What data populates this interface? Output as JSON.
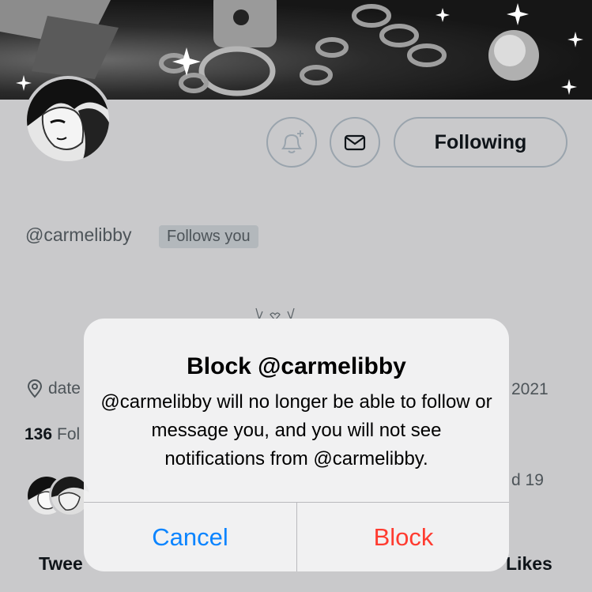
{
  "profile": {
    "handle": "@carmelibby",
    "follows_you_badge": "Follows you",
    "location": "date",
    "joined_fragment": "2021",
    "followers_count": "136",
    "followers_label": "Fol",
    "followed_by_fragment": "d 19",
    "bio_glyph": "ᶻ♡ᶻ"
  },
  "actions": {
    "notify_icon": "bell-plus-icon",
    "message_icon": "envelope-icon",
    "following_label": "Following"
  },
  "tabs": {
    "first": "Twee",
    "last": "Likes"
  },
  "alert": {
    "title": "Block @carmelibby",
    "message": "@carmelibby will no longer be able to follow or message you, and you will not see notifications from @carmelibby.",
    "cancel_label": "Cancel",
    "block_label": "Block"
  },
  "colors": {
    "cancel": "#0a84ff",
    "block": "#ff3b30",
    "dim_background": "#c9c9cb"
  }
}
